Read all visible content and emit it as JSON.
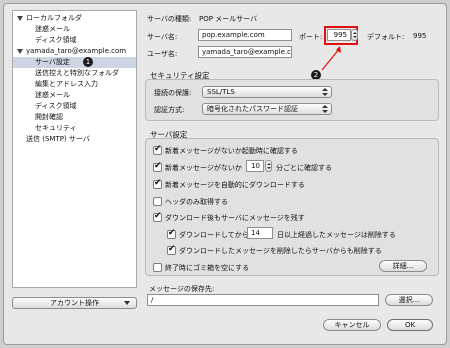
{
  "sidebar": {
    "items": [
      {
        "label": "ローカルフォルダ",
        "level": 0
      },
      {
        "label": "迷惑メール",
        "level": 1
      },
      {
        "label": "ディスク領域",
        "level": 1
      },
      {
        "label": "yamada_taro@example.com",
        "level": 0
      },
      {
        "label": "サーバ設定",
        "level": 1,
        "selected": true
      },
      {
        "label": "送信控えと特別なフォルダ",
        "level": 1
      },
      {
        "label": "編集とアドレス入力",
        "level": 1
      },
      {
        "label": "迷惑メール",
        "level": 1
      },
      {
        "label": "ディスク領域",
        "level": 1
      },
      {
        "label": "開封確認",
        "level": 1
      },
      {
        "label": "セキュリティ",
        "level": 1
      },
      {
        "label": "送信 (SMTP) サーバ",
        "level": 0
      }
    ],
    "callout_1": "1",
    "account_actions_label": "アカウント操作"
  },
  "server": {
    "type_label": "サーバの種類:",
    "type_value": "POP メールサーバ",
    "name_label": "サーバ名:",
    "name_value": "pop.example.com",
    "port_label": "ポート:",
    "port_value": "995",
    "default_label": "デフォルト:",
    "default_value": "995",
    "user_label": "ユーザ名:",
    "user_value": "yamada_taro@example.co",
    "callout_2": "2"
  },
  "security": {
    "title": "セキュリティ設定",
    "protection_label": "接続の保護:",
    "protection_value": "SSL/TLS",
    "auth_label": "認証方式:",
    "auth_value": "暗号化されたパスワード認証"
  },
  "server_settings": {
    "title": "サーバ設定",
    "check_on_startup": "新着メッセージがないか起動時に確認する",
    "check_every_prefix": "新着メッセージがないか",
    "check_every_value": "10",
    "check_every_suffix": "分ごとに確認する",
    "auto_download": "新着メッセージを自動的にダウンロードする",
    "headers_only": "ヘッダのみ取得する",
    "leave_on_server": "ダウンロード後もサーバにメッセージを残す",
    "delete_after_prefix": "ダウンロードしてから",
    "delete_after_value": "14",
    "delete_after_suffix": "日以上経過したメッセージは削除する",
    "delete_when_removed": "ダウンロードしたメッセージを削除したらサーバからも削除する",
    "empty_trash": "終了時にゴミ箱を空にする",
    "advanced_button": "詳細..."
  },
  "storage": {
    "label": "メッセージの保存先:",
    "path": "/",
    "browse_button": "選択..."
  },
  "footer": {
    "cancel": "キャンセル",
    "ok": "OK"
  },
  "colors": {
    "callout": "#e01010",
    "selection": "#cdd5e3"
  }
}
